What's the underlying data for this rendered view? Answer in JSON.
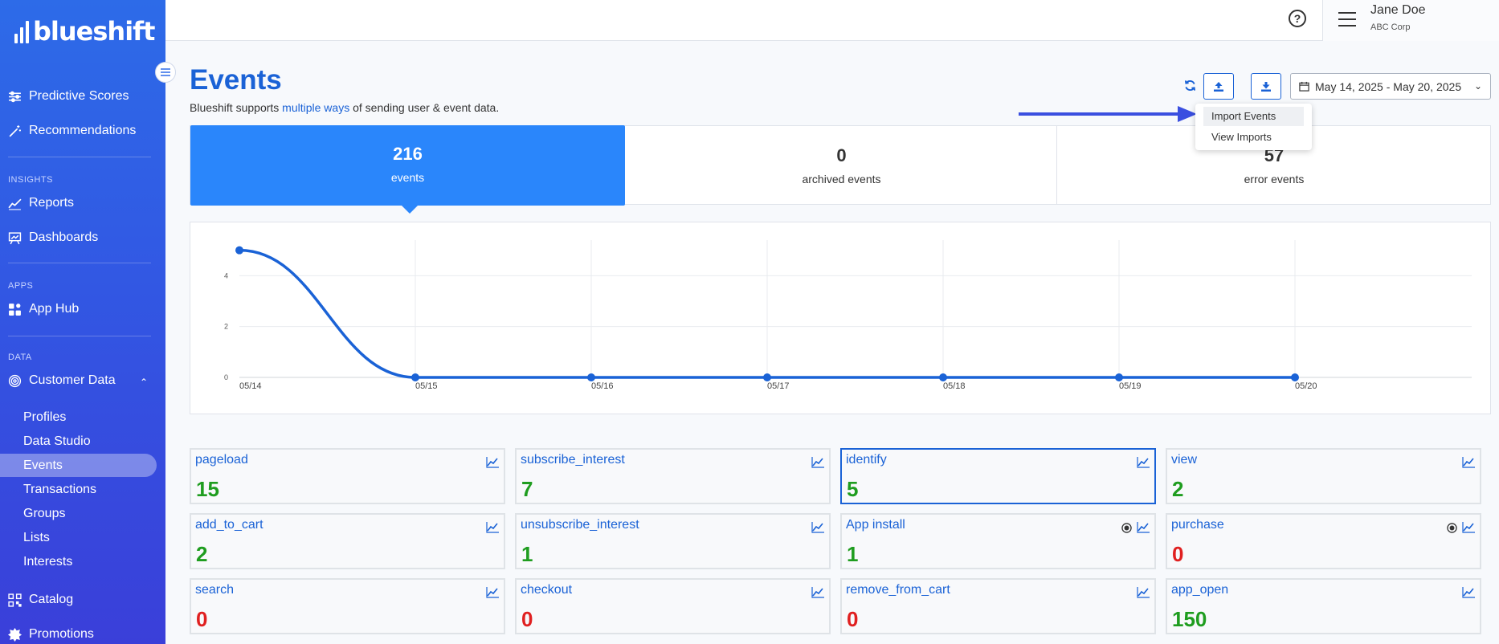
{
  "brand": {
    "logo_text": "blueshift"
  },
  "sidebar": {
    "predictive_scores": "Predictive Scores",
    "recommendations": "Recommendations",
    "insights_label": "INSIGHTS",
    "reports": "Reports",
    "dashboards": "Dashboards",
    "apps_label": "APPS",
    "app_hub": "App Hub",
    "data_label": "DATA",
    "customer_data": "Customer Data",
    "sub_items": [
      "Profiles",
      "Data Studio",
      "Events",
      "Transactions",
      "Groups",
      "Lists",
      "Interests"
    ],
    "active_sub_item": "Events",
    "catalog": "Catalog",
    "promotions": "Promotions"
  },
  "header": {
    "help_icon": "?",
    "user_name": "Jane Doe",
    "user_org": "ABC Corp"
  },
  "page": {
    "title": "Events",
    "desc_before": "Blueshift supports ",
    "desc_link": "multiple ways",
    "desc_after": " of sending user & event data.",
    "date_range": "May 14, 2025 - May 20, 2025"
  },
  "dropdown": {
    "items": [
      "Import Events",
      "View Imports"
    ],
    "highlighted": "Import Events"
  },
  "stats": [
    {
      "value": "216",
      "label": "events"
    },
    {
      "value": "0",
      "label": "archived events"
    },
    {
      "value": "57",
      "label": "error events"
    }
  ],
  "chart_data": {
    "type": "line",
    "categories": [
      "05/14",
      "05/15",
      "05/16",
      "05/17",
      "05/18",
      "05/19",
      "05/20"
    ],
    "series": [
      {
        "values": [
          5,
          0,
          0,
          0,
          0,
          0,
          0
        ]
      }
    ],
    "yticks": [
      "0",
      "2",
      "4"
    ],
    "ylim": [
      0,
      5.4
    ],
    "grid": true,
    "color": "#1a62d6"
  },
  "event_cards": [
    {
      "name": "pageload",
      "value": "15",
      "status": "positive"
    },
    {
      "name": "subscribe_interest",
      "value": "7",
      "status": "positive"
    },
    {
      "name": "identify",
      "value": "5",
      "status": "positive",
      "selected": true
    },
    {
      "name": "view",
      "value": "2",
      "status": "positive"
    },
    {
      "name": "add_to_cart",
      "value": "2",
      "status": "positive"
    },
    {
      "name": "unsubscribe_interest",
      "value": "1",
      "status": "positive"
    },
    {
      "name": "App install",
      "value": "1",
      "status": "positive",
      "target_icon": true
    },
    {
      "name": "purchase",
      "value": "0",
      "status": "zero",
      "target_icon": true
    },
    {
      "name": "search",
      "value": "0",
      "status": "zero"
    },
    {
      "name": "checkout",
      "value": "0",
      "status": "zero"
    },
    {
      "name": "remove_from_cart",
      "value": "0",
      "status": "zero"
    },
    {
      "name": "app_open",
      "value": "150",
      "status": "positive"
    }
  ],
  "colors": {
    "positive": "#1f9d1f",
    "zero": "#e02020",
    "accent": "#1a62d6"
  }
}
